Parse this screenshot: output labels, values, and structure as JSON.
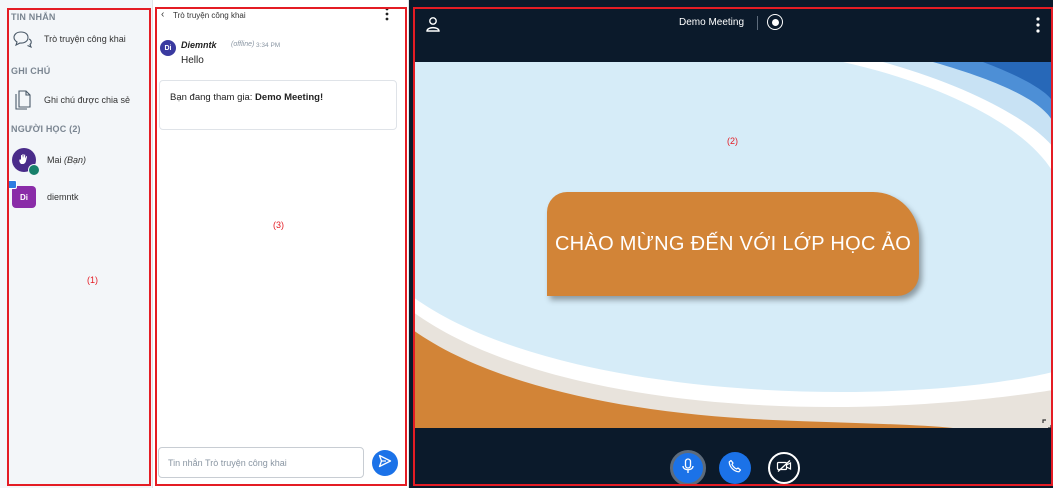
{
  "sidebar": {
    "messages_title": "TIN NHẮN",
    "public_chat_label": "Trò truyện công khai",
    "notes_title": "GHI CHÚ",
    "shared_notes_label": "Ghi chú được chia sẻ",
    "users_title": "NGƯỜI HỌC (2)",
    "users": [
      {
        "initials": "",
        "name": "Mai",
        "suffix": "(Bạn)",
        "color": "#4a2c8a",
        "icon": "hand-icon"
      },
      {
        "initials": "Di",
        "name": "diemntk",
        "suffix": "",
        "color": "#8a2ca8"
      }
    ]
  },
  "chat": {
    "title": "Trò truyện công khai",
    "messages": [
      {
        "avatar": "Di",
        "author": "Diemntk",
        "status": "(offline)",
        "time": "3:34 PM",
        "text": "Hello"
      }
    ],
    "welcome_prefix": "Bạn đang tham gia: ",
    "welcome_meeting": "Demo Meeting",
    "welcome_suffix": "!",
    "input_placeholder": "Tin nhắn Trò truyện công khai"
  },
  "stage": {
    "meeting_title": "Demo Meeting",
    "slide_heading": "CHÀO MỪNG ĐẾN VỚI LỚP HỌC ẢO",
    "controls": [
      "microphone-icon",
      "phone-icon",
      "camera-off-icon"
    ]
  },
  "annotations": {
    "sidebar_label": "(1)",
    "stage_label": "(2)",
    "chat_label": "(3)",
    "color": "#e41c24"
  },
  "colors": {
    "accent": "#1b72e8",
    "dark_bg": "#0b1a2b",
    "slide_orange": "#d28437",
    "slide_blue": "#d6ecf8"
  }
}
